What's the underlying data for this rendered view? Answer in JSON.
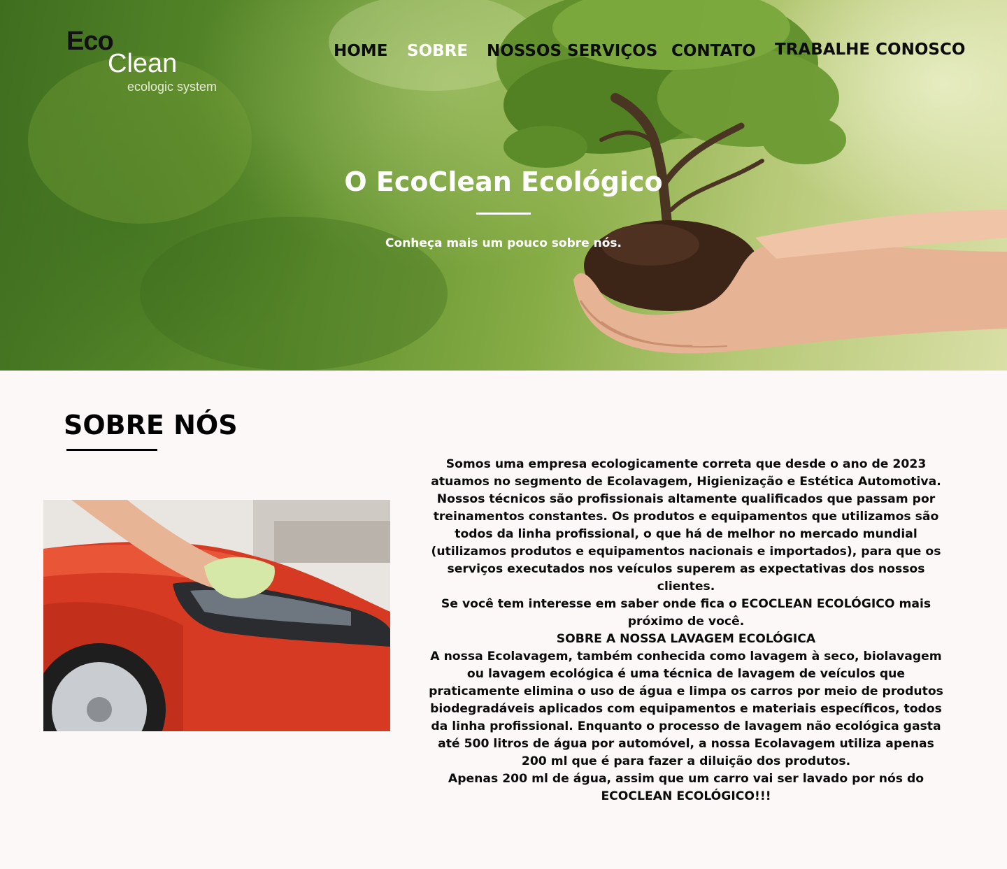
{
  "logo": {
    "eco": "Eco",
    "clean": "Clean",
    "tagline": "ecologic system"
  },
  "nav": {
    "items": [
      {
        "label": "HOME",
        "active": false
      },
      {
        "label": "SOBRE",
        "active": true
      },
      {
        "label": "NOSSOS SERVIÇOS",
        "active": false
      },
      {
        "label": "CONTATO",
        "active": false
      },
      {
        "label": "TRABALHE CONOSCO",
        "active": false
      }
    ]
  },
  "hero": {
    "title": "O EcoClean Ecológico",
    "subtitle": "Conheça mais um pouco sobre nós."
  },
  "about": {
    "title": "SOBRE NÓS",
    "paragraphs": [
      "Somos uma empresa ecologicamente correta que desde o ano de 2023 atuamos no segmento de Ecolavagem, Higienização e Estética Automotiva. Nossos técnicos são profissionais altamente qualificados que passam por treinamentos constantes. Os produtos e equipamentos que utilizamos são todos da linha profissional, o que há de melhor no mercado mundial (utilizamos produtos e equipamentos nacionais e importados), para que os serviços executados nos veículos superem as expectativas dos nossos clientes.",
      "Se você tem interesse em saber onde fica o ECOCLEAN ECOLÓGICO mais próximo de você.",
      "SOBRE A NOSSA LAVAGEM ECOLÓGICA",
      "A nossa Ecolavagem, também conhecida como lavagem à seco, biolavagem ou lavagem ecológica é uma técnica de lavagem de veículos que praticamente elimina o uso de água e limpa os carros por meio de produtos biodegradáveis aplicados com equipamentos e materiais específicos, todos da linha profissional. Enquanto o processo de lavagem não ecológica gasta até 500 litros de água por automóvel, a nossa Ecolavagem utiliza apenas 200 ml que é para fazer a diluição dos produtos.",
      "Apenas 200 ml de água, assim que um carro vai ser lavado por nós do ECOCLEAN ECOLÓGICO!!!"
    ]
  },
  "colors": {
    "hero_green": "#5d8e2c",
    "page_bg": "#fcf8f7",
    "car_red": "#d63a22",
    "active_nav": "#ffffff"
  }
}
